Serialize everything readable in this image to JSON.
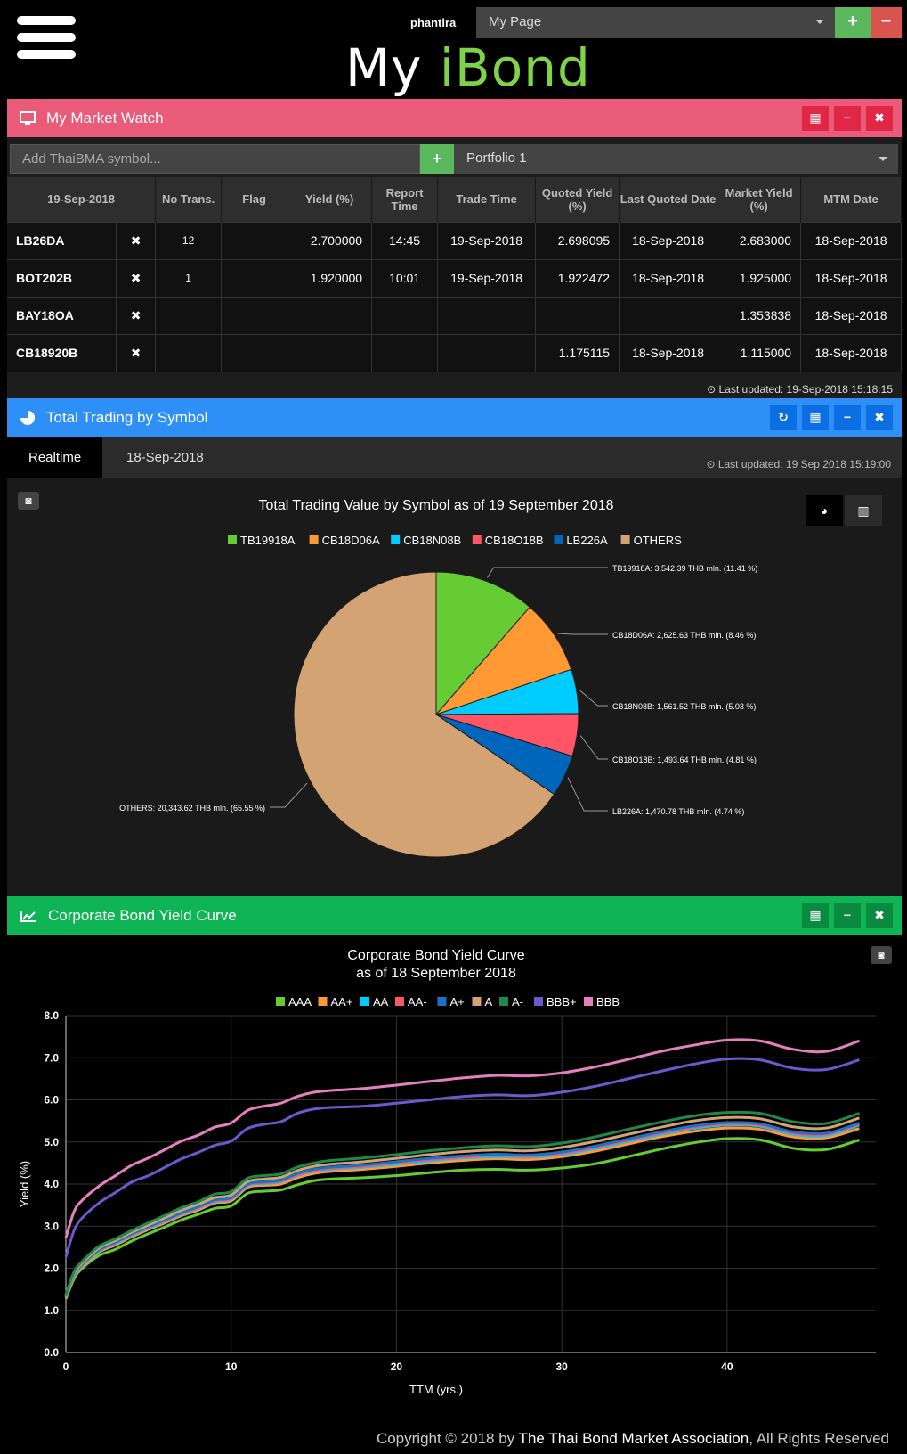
{
  "header": {
    "user": "phantira",
    "page_select": "My Page",
    "add_page": "+",
    "remove_page": "−",
    "logo_my": "My ",
    "logo_i": "iBond"
  },
  "market_watch": {
    "title": "My Market Watch",
    "symbol_placeholder": "Add ThaiBMA symbol...",
    "add_symbol": "+",
    "portfolio": "Portfolio 1",
    "columns": [
      "19-Sep-2018",
      "No Trans.",
      "Flag",
      "Yield (%)",
      "Report Time",
      "Trade Time",
      "Quoted Yield (%)",
      "Last Quoted Date",
      "Market Yield (%)",
      "MTM Date"
    ],
    "rows": [
      {
        "symbol": "LB26DA",
        "remove": "✖",
        "no_trans": "12",
        "flag": "",
        "yield": "2.700000",
        "report_time": "14:45",
        "trade_time": "19-Sep-2018",
        "quoted_yield": "2.698095",
        "last_quoted_date": "18-Sep-2018",
        "market_yield": "2.683000",
        "mtm_date": "18-Sep-2018"
      },
      {
        "symbol": "BOT202B",
        "remove": "✖",
        "no_trans": "1",
        "flag": "",
        "yield": "1.920000",
        "report_time": "10:01",
        "trade_time": "19-Sep-2018",
        "quoted_yield": "1.922472",
        "last_quoted_date": "18-Sep-2018",
        "market_yield": "1.925000",
        "mtm_date": "18-Sep-2018"
      },
      {
        "symbol": "BAY18OA",
        "remove": "✖",
        "no_trans": "",
        "flag": "",
        "yield": "",
        "report_time": "",
        "trade_time": "",
        "quoted_yield": "",
        "last_quoted_date": "",
        "market_yield": "1.353838",
        "mtm_date": "18-Sep-2018"
      },
      {
        "symbol": "CB18920B",
        "remove": "✖",
        "no_trans": "",
        "flag": "",
        "yield": "",
        "report_time": "",
        "trade_time": "",
        "quoted_yield": "1.175115",
        "last_quoted_date": "18-Sep-2018",
        "market_yield": "1.115000",
        "mtm_date": "18-Sep-2018"
      }
    ],
    "last_updated": "Last updated: 19-Sep-2018 15:18:15"
  },
  "trading": {
    "title": "Total Trading by Symbol",
    "tab_realtime": "Realtime",
    "tab_prev": "18-Sep-2018",
    "last_updated": "Last updated:  19 Sep 2018 15:19:00"
  },
  "yield_curve": {
    "title": "Corporate Bond Yield Curve"
  },
  "footer": {
    "prefix": "Copyright © 2018 by ",
    "org": "The Thai Bond Market Association",
    "suffix": ", All Rights Reserved"
  },
  "chart_data": [
    {
      "type": "pie",
      "title": "Total Trading Value by Symbol as of 19 September 2018",
      "legend_placement": "top",
      "slices": [
        {
          "name": "TB19918A",
          "value": 3542.39,
          "label": "TB19918A: 3,542.39 THB mln. (11.41 %)",
          "color": "#66cc33"
        },
        {
          "name": "CB18D06A",
          "value": 2625.63,
          "label": "CB18D06A: 2,625.63 THB mln. (8.46 %)",
          "color": "#ff9933"
        },
        {
          "name": "CB18N08B",
          "value": 1561.52,
          "label": "CB18N08B: 1,561.52 THB mln. (5.03 %)",
          "color": "#00ccff"
        },
        {
          "name": "CB18O18B",
          "value": 1493.64,
          "label": "CB18O18B: 1,493.64 THB mln. (4.81 %)",
          "color": "#ff5566"
        },
        {
          "name": "LB226A",
          "value": 1470.78,
          "label": "LB226A: 1,470.78 THB mln. (4.74 %)",
          "color": "#0066bb"
        },
        {
          "name": "OTHERS",
          "value": 20343.62,
          "label": "OTHERS: 20,343.62 THB mln. (65.55 %)",
          "color": "#d4a373"
        }
      ]
    },
    {
      "type": "line",
      "title": "Corporate Bond Yield Curve",
      "subtitle": "as of 18 September 2018",
      "xlabel": "TTM (yrs.)",
      "ylabel": "Yield (%)",
      "xlim": [
        0,
        49
      ],
      "ylim": [
        0,
        8
      ],
      "xticks": [
        0,
        10,
        20,
        30,
        40
      ],
      "yticks": [
        "0.0",
        "1.0",
        "2.0",
        "3.0",
        "4.0",
        "5.0",
        "6.0",
        "7.0",
        "8.0"
      ],
      "grid": true,
      "legend_placement": "top",
      "x": [
        0,
        0.5,
        1,
        2,
        3,
        4,
        5,
        6,
        7,
        8,
        9,
        10,
        11,
        12,
        13,
        14,
        15,
        16,
        18,
        20,
        22,
        24,
        26,
        28,
        30,
        32,
        34,
        36,
        38,
        40,
        42,
        44,
        46,
        48
      ],
      "series": [
        {
          "name": "AAA",
          "color": "#66cc33",
          "values": [
            1.27,
            1.75,
            2.0,
            2.3,
            2.45,
            2.65,
            2.82,
            2.98,
            3.15,
            3.28,
            3.42,
            3.48,
            3.78,
            3.83,
            3.86,
            3.98,
            4.08,
            4.12,
            4.15,
            4.2,
            4.27,
            4.33,
            4.35,
            4.33,
            4.38,
            4.48,
            4.65,
            4.83,
            4.98,
            5.08,
            5.05,
            4.85,
            4.82,
            5.05
          ]
        },
        {
          "name": "AA+",
          "color": "#ff9933",
          "values": [
            1.31,
            1.8,
            2.05,
            2.38,
            2.55,
            2.75,
            2.92,
            3.08,
            3.25,
            3.38,
            3.55,
            3.6,
            3.92,
            3.97,
            4.0,
            4.15,
            4.25,
            4.3,
            4.35,
            4.42,
            4.5,
            4.56,
            4.6,
            4.58,
            4.65,
            4.78,
            4.95,
            5.12,
            5.25,
            5.33,
            5.3,
            5.12,
            5.1,
            5.32
          ]
        },
        {
          "name": "AA",
          "color": "#00ccff",
          "values": [
            1.32,
            1.82,
            2.07,
            2.4,
            2.58,
            2.78,
            2.95,
            3.11,
            3.28,
            3.42,
            3.58,
            3.64,
            3.96,
            4.01,
            4.05,
            4.2,
            4.3,
            4.35,
            4.4,
            4.47,
            4.55,
            4.62,
            4.65,
            4.64,
            4.7,
            4.84,
            5.01,
            5.18,
            5.32,
            5.4,
            5.37,
            5.18,
            5.15,
            5.4
          ]
        },
        {
          "name": "AA-",
          "color": "#ff5566",
          "values": [
            1.33,
            1.83,
            2.08,
            2.42,
            2.6,
            2.8,
            2.97,
            3.13,
            3.3,
            3.44,
            3.6,
            3.66,
            3.98,
            4.03,
            4.07,
            4.22,
            4.32,
            4.37,
            4.42,
            4.5,
            4.58,
            4.64,
            4.68,
            4.66,
            4.73,
            4.87,
            5.04,
            5.21,
            5.35,
            5.43,
            5.4,
            5.21,
            5.18,
            5.43
          ]
        },
        {
          "name": "A+",
          "color": "#1a73c8",
          "values": [
            1.34,
            1.85,
            2.1,
            2.44,
            2.62,
            2.82,
            2.99,
            3.15,
            3.32,
            3.46,
            3.62,
            3.68,
            4.0,
            4.05,
            4.09,
            4.25,
            4.35,
            4.4,
            4.45,
            4.53,
            4.61,
            4.67,
            4.71,
            4.69,
            4.76,
            4.9,
            5.07,
            5.24,
            5.38,
            5.46,
            5.43,
            5.24,
            5.21,
            5.45
          ]
        },
        {
          "name": "A",
          "color": "#d4a373",
          "values": [
            1.36,
            1.88,
            2.13,
            2.48,
            2.66,
            2.86,
            3.03,
            3.2,
            3.38,
            3.52,
            3.68,
            3.74,
            4.06,
            4.12,
            4.16,
            4.32,
            4.42,
            4.47,
            4.53,
            4.61,
            4.7,
            4.77,
            4.81,
            4.79,
            4.87,
            5.01,
            5.18,
            5.35,
            5.5,
            5.58,
            5.55,
            5.36,
            5.33,
            5.57
          ]
        },
        {
          "name": "A-",
          "color": "#1d8a4a",
          "values": [
            1.38,
            1.92,
            2.17,
            2.52,
            2.7,
            2.9,
            3.08,
            3.26,
            3.44,
            3.58,
            3.76,
            3.82,
            4.14,
            4.2,
            4.24,
            4.4,
            4.5,
            4.56,
            4.62,
            4.7,
            4.79,
            4.86,
            4.91,
            4.89,
            4.97,
            5.12,
            5.3,
            5.47,
            5.62,
            5.7,
            5.68,
            5.48,
            5.44,
            5.68
          ]
        },
        {
          "name": "BBB+",
          "color": "#6a5acd",
          "values": [
            2.27,
            2.9,
            3.2,
            3.55,
            3.8,
            4.05,
            4.2,
            4.4,
            4.6,
            4.75,
            4.92,
            5.02,
            5.32,
            5.42,
            5.48,
            5.68,
            5.78,
            5.82,
            5.85,
            5.92,
            6.0,
            6.08,
            6.12,
            6.1,
            6.18,
            6.32,
            6.5,
            6.68,
            6.85,
            6.97,
            6.95,
            6.75,
            6.72,
            6.95
          ]
        },
        {
          "name": "BBB",
          "color": "#e47fc0",
          "values": [
            2.72,
            3.35,
            3.62,
            3.95,
            4.2,
            4.45,
            4.62,
            4.82,
            5.02,
            5.16,
            5.35,
            5.45,
            5.75,
            5.85,
            5.92,
            6.08,
            6.18,
            6.22,
            6.27,
            6.35,
            6.44,
            6.52,
            6.58,
            6.57,
            6.64,
            6.78,
            6.96,
            7.15,
            7.3,
            7.42,
            7.4,
            7.2,
            7.15,
            7.4
          ]
        }
      ]
    }
  ]
}
